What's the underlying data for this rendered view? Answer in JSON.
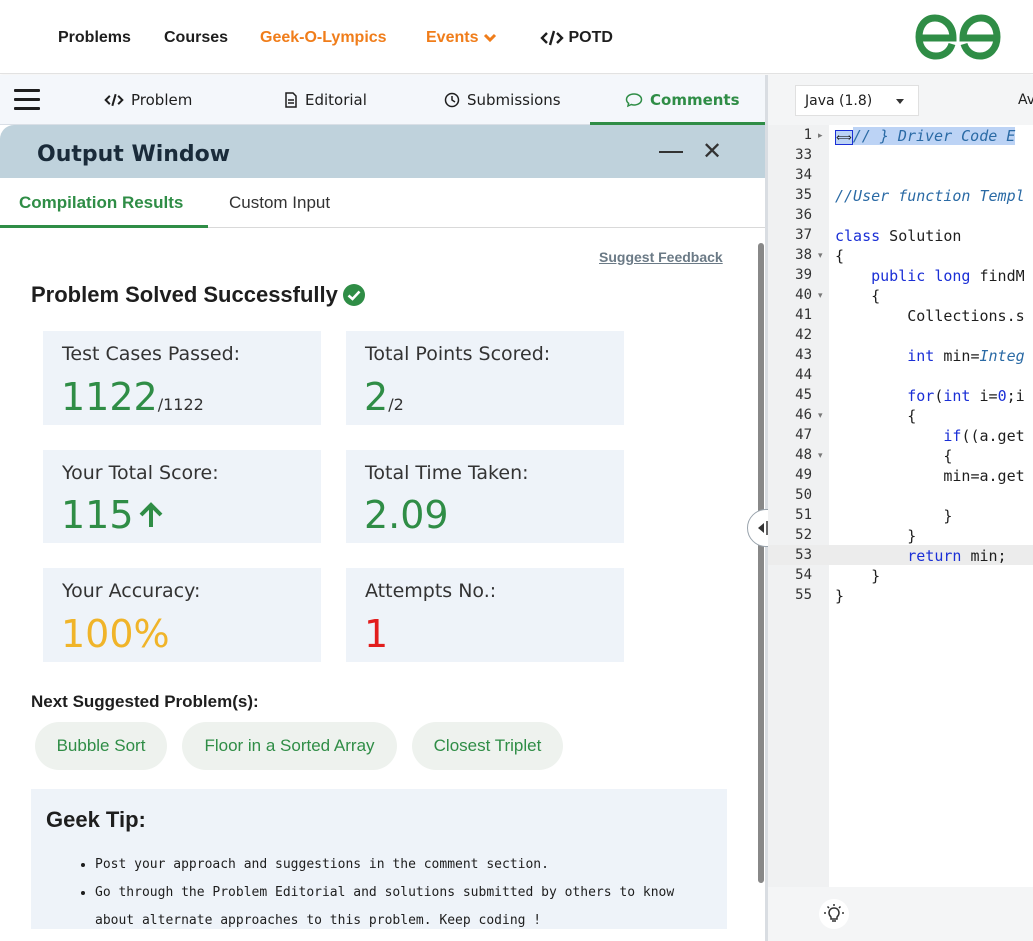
{
  "navbar": {
    "items": [
      "Problems",
      "Courses",
      "Geek-O-Lympics",
      "Events",
      "POTD"
    ]
  },
  "tabs": {
    "problem": "Problem",
    "editorial": "Editorial",
    "submissions": "Submissions",
    "comments": "Comments"
  },
  "output": {
    "title": "Output Window",
    "compilation": "Compilation Results",
    "custom_input": "Custom Input",
    "suggest_feedback": "Suggest Feedback",
    "solved": "Problem Solved Successfully"
  },
  "cards": {
    "test_cases_label": "Test Cases Passed:",
    "test_cases_value": "1122",
    "test_cases_total": "/1122",
    "points_label": "Total Points Scored:",
    "points_value": "2",
    "points_total": "/2",
    "score_label": "Your Total Score:",
    "score_value": "115",
    "time_label": "Total Time Taken:",
    "time_value": "2.09",
    "accuracy_label": "Your Accuracy:",
    "accuracy_value": "100%",
    "attempts_label": "Attempts No.:",
    "attempts_value": "1"
  },
  "next": {
    "title": "Next Suggested Problem(s):",
    "problems": [
      "Bubble Sort",
      "Floor in a Sorted Array",
      "Closest Triplet"
    ]
  },
  "tip": {
    "title": "Geek Tip:",
    "items": [
      "Post your approach and suggestions in the comment section.",
      "Go through the Problem Editorial and solutions submitted by others to know about alternate approaches to this problem. Keep coding !"
    ]
  },
  "editor": {
    "language": "Java (1.8)",
    "av_label": "Av",
    "lines": [
      {
        "n": "1",
        "text": "// } Driver Code E"
      },
      {
        "n": "33",
        "text": ""
      },
      {
        "n": "34",
        "text": ""
      },
      {
        "n": "35",
        "text": "//User function Templ"
      },
      {
        "n": "36",
        "text": ""
      },
      {
        "n": "37",
        "text": "class Solution"
      },
      {
        "n": "38",
        "text": "{"
      },
      {
        "n": "39",
        "text": "    public long findM"
      },
      {
        "n": "40",
        "text": "    {"
      },
      {
        "n": "41",
        "text": "        Collections.s"
      },
      {
        "n": "42",
        "text": ""
      },
      {
        "n": "43",
        "text": "        int min=Integ"
      },
      {
        "n": "44",
        "text": ""
      },
      {
        "n": "45",
        "text": "        for(int i=0;i"
      },
      {
        "n": "46",
        "text": "        {"
      },
      {
        "n": "47",
        "text": "            if((a.get"
      },
      {
        "n": "48",
        "text": "            {"
      },
      {
        "n": "49",
        "text": "            min=a.get"
      },
      {
        "n": "50",
        "text": ""
      },
      {
        "n": "51",
        "text": "            }"
      },
      {
        "n": "52",
        "text": "        }"
      },
      {
        "n": "53",
        "text": "        return min;"
      },
      {
        "n": "54",
        "text": "    }"
      },
      {
        "n": "55",
        "text": "}"
      }
    ]
  },
  "colors": {
    "brand_green": "#2f8d46",
    "orange": "#f07d1a",
    "yellow": "#f0b429",
    "red": "#e21d1d"
  }
}
